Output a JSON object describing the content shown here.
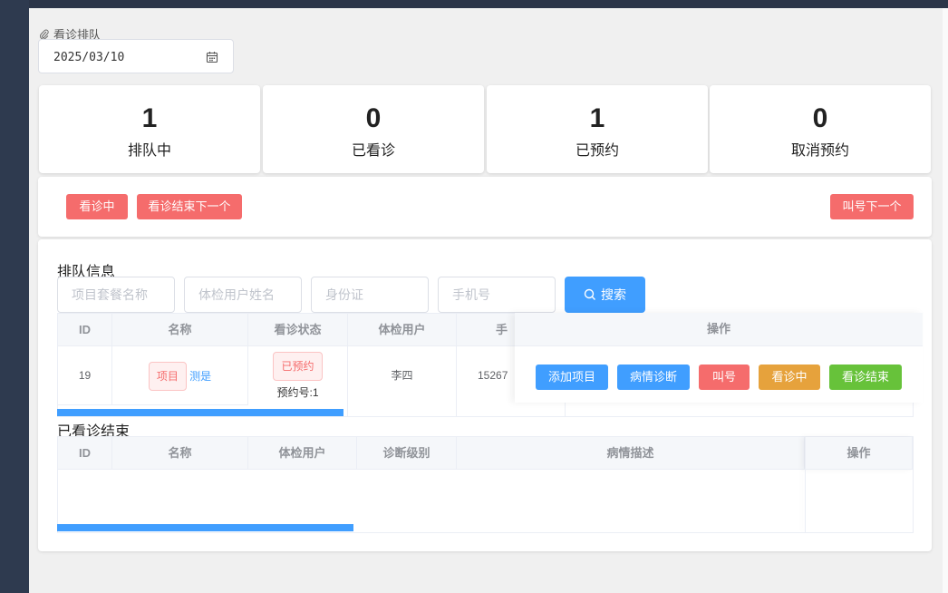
{
  "page": {
    "title": "看诊排队"
  },
  "date_picker": {
    "value": "2025/03/10"
  },
  "stats": [
    {
      "value": "1",
      "label": "排队中"
    },
    {
      "value": "0",
      "label": "已看诊"
    },
    {
      "value": "1",
      "label": "已预约"
    },
    {
      "value": "0",
      "label": "取消预约"
    }
  ],
  "actions": {
    "in_consult": "看诊中",
    "finish_next": "看诊结束下一个",
    "call_next": "叫号下一个"
  },
  "queue": {
    "title": "排队信息",
    "filters": {
      "package_placeholder": "项目套餐名称",
      "user_placeholder": "体检用户姓名",
      "id_placeholder": "身份证",
      "phone_placeholder": "手机号",
      "search_label": "搜索"
    },
    "columns": {
      "id": "ID",
      "name": "名称",
      "status": "看诊状态",
      "user": "体检用户",
      "phone": "手",
      "ops": "操作"
    },
    "rows": [
      {
        "id": "19",
        "name_tag": "项目",
        "name_link": "测是",
        "status_tag": "已预约",
        "appointment": "预约号:1",
        "user": "李四",
        "phone": "15267"
      }
    ],
    "row_ops": {
      "add_item": "添加项目",
      "diagnose": "病情诊断",
      "call": "叫号",
      "in_consult": "看诊中",
      "finish": "看诊结束"
    }
  },
  "finished": {
    "title": "已看诊结束",
    "columns": {
      "id": "ID",
      "name": "名称",
      "user": "体检用户",
      "level": "诊断级别",
      "desc": "病情描述",
      "ops": "操作"
    }
  },
  "colors": {
    "primary": "#409eff",
    "danger": "#f56c6c",
    "warning": "#e6a23c",
    "success": "#67c23a",
    "sidebar": "#2e3a4f"
  }
}
